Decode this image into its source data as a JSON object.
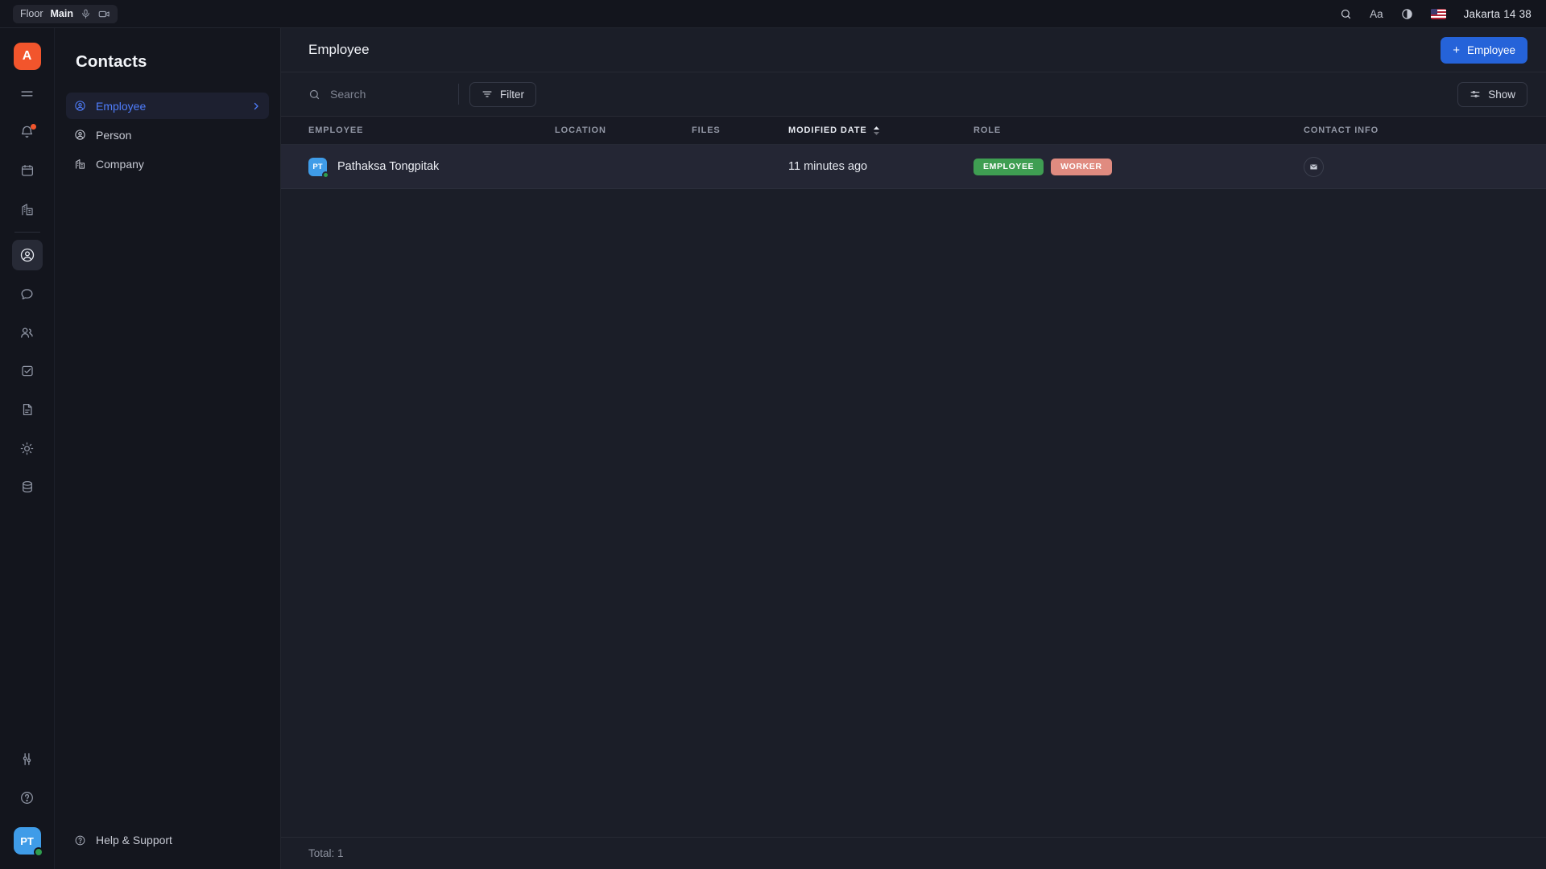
{
  "topbar": {
    "floor_label": "Floor",
    "floor_value": "Main",
    "mic_icon": "microphone-icon",
    "camera_icon": "video-camera-icon",
    "search_icon": "search-icon",
    "font_size_label": "Aa",
    "theme_icon": "contrast-half-circle-icon",
    "flag_icon": "us-flag-icon",
    "clock": "Jakarta  14 38"
  },
  "rail": {
    "logo": "A",
    "items": [
      {
        "name": "menu-icon"
      },
      {
        "name": "bell-icon",
        "badge": true
      },
      {
        "name": "calendar-icon"
      },
      {
        "name": "building-icon"
      },
      {
        "name": "contacts-icon",
        "active": true
      },
      {
        "name": "chat-bubble-icon"
      },
      {
        "name": "people-icon"
      },
      {
        "name": "task-check-icon"
      },
      {
        "name": "document-icon"
      },
      {
        "name": "sun-icon"
      },
      {
        "name": "database-icon"
      },
      {
        "name": "sliders-icon"
      },
      {
        "name": "help-circle-icon"
      }
    ],
    "avatar_initials": "PT"
  },
  "sidebar": {
    "title": "Contacts",
    "items": [
      {
        "label": "Employee",
        "icon": "user-circle-icon",
        "active": true,
        "chevron": "chevron-right-icon"
      },
      {
        "label": "Person",
        "icon": "user-circle-icon",
        "active": false
      },
      {
        "label": "Company",
        "icon": "building-icon",
        "active": false
      }
    ],
    "help": {
      "label": "Help & Support",
      "icon": "help-circle-icon"
    }
  },
  "main": {
    "page_title": "Employee",
    "add_button": {
      "label": "Employee",
      "plus": "+"
    },
    "search": {
      "placeholder": "Search",
      "value": "",
      "icon": "search-icon"
    },
    "filter_button": {
      "label": "Filter",
      "icon": "filter-lines-icon"
    },
    "show_button": {
      "label": "Show",
      "icon": "sliders-icon"
    },
    "footer_total": "Total: 1"
  },
  "table": {
    "columns": [
      {
        "key": "employee",
        "label": "EMPLOYEE",
        "sorted": false
      },
      {
        "key": "location",
        "label": "LOCATION",
        "sorted": false
      },
      {
        "key": "files",
        "label": "FILES",
        "sorted": false
      },
      {
        "key": "modified_date",
        "label": "MODIFIED DATE",
        "sorted": true,
        "sort_dir": "asc"
      },
      {
        "key": "role",
        "label": "ROLE",
        "sorted": false
      },
      {
        "key": "contact_info",
        "label": "CONTACT INFO",
        "sorted": false
      }
    ],
    "rows": [
      {
        "avatar_initials": "PT",
        "employee": "Pathaksa Tongpitak",
        "location": "",
        "files": "",
        "modified_date": "11 minutes ago",
        "roles": [
          {
            "label": "EMPLOYEE",
            "color": "#3f9e52"
          },
          {
            "label": "WORKER",
            "color": "#e08b80"
          }
        ],
        "contact_icon": "mail-icon",
        "presence": "online"
      }
    ]
  },
  "colors": {
    "accent_blue": "#2563d9",
    "link_blue": "#4f7dfb",
    "brand_orange": "#f2552c",
    "avatar_blue": "#3f9ce8",
    "presence_green": "#2f9e4f",
    "chip_green": "#3f9e52",
    "chip_salmon": "#e08b80",
    "bg_dark": "#13151d",
    "bg_main": "#1b1e28",
    "row_bg": "#242634"
  }
}
